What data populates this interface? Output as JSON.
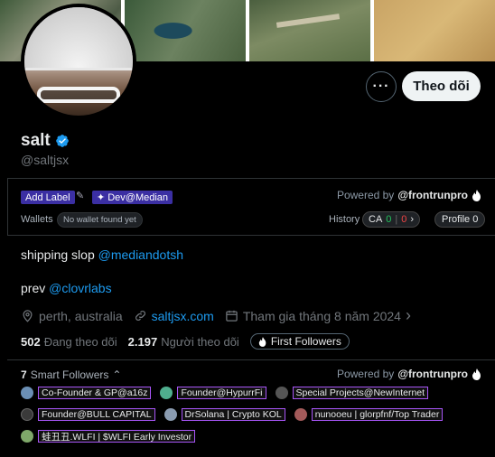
{
  "profile": {
    "name": "salt",
    "handle": "@saltjsx",
    "follow_label": "Theo dõi",
    "more_label": "···"
  },
  "extension": {
    "add_label": "Add Label",
    "tag": "Dev@Median",
    "powered_by": "Powered by",
    "powered_brand": "@frontrunpro",
    "wallets_label": "Wallets",
    "no_wallet": "No wallet found yet",
    "history_label": "History",
    "ca_label": "CA",
    "ca_green": "0",
    "ca_red": "0",
    "profile_label": "Profile",
    "profile_count": "0"
  },
  "bio": {
    "line1_text": "shipping slop ",
    "line1_link": "@mediandotsh",
    "line2_text": "prev ",
    "line2_link": "@clovrlabs"
  },
  "meta": {
    "location": "perth, australia",
    "website": "saltjsx.com",
    "joined": "Tham gia tháng 8 năm 2024"
  },
  "stats": {
    "following_count": "502",
    "following_label": "Đang theo dõi",
    "followers_count": "2.197",
    "followers_label": "Người theo dõi",
    "first_followers": "First Followers"
  },
  "smart_followers": {
    "count": "7",
    "label": "Smart Followers",
    "powered_by": "Powered by",
    "powered_brand": "@frontrunpro",
    "rows": [
      [
        {
          "tag": "Co-Founder & GP@a16z",
          "color": "#6b8fb5"
        },
        {
          "tag": "Founder@HypurrFi",
          "color": "#4fae8e"
        },
        {
          "tag": "Special Projects@NewInternet",
          "color": "#555555"
        }
      ],
      [
        {
          "tag": "Founder@BULL CAPITAL",
          "color": "#3a3a3a"
        },
        {
          "tag": "DrSolana | Crypto KOL",
          "color": "#8a9bb0"
        },
        {
          "tag": "nunooeu | glorpfnf/Top Trader",
          "color": "#a35a5a"
        }
      ],
      [
        {
          "tag": "蛙丑丑.WLFI | $WLFI Early Investor",
          "color": "#7fa86a"
        }
      ]
    ]
  },
  "colors": {
    "accent": "#1d9bf0",
    "label_bg": "#3b2fa3",
    "tag_border": "#a855f7"
  }
}
